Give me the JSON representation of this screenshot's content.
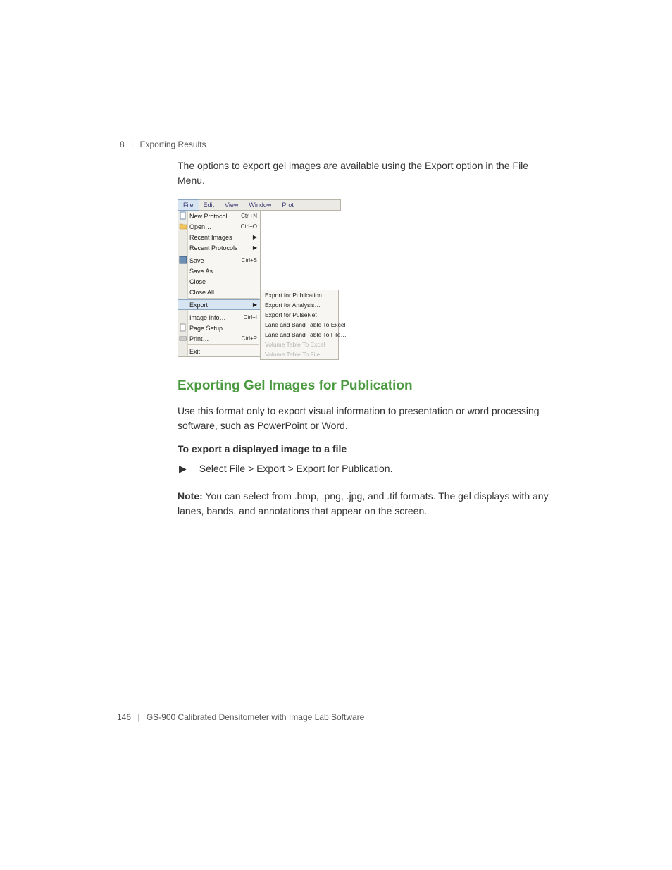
{
  "header": {
    "chapter": "8",
    "title": "Exporting Results"
  },
  "intro": "The options to export gel images are available using the Export option in the File Menu.",
  "menubar": [
    "File",
    "Edit",
    "View",
    "Window",
    "Prot"
  ],
  "menu": {
    "new_protocol": "New Protocol…",
    "new_protocol_sc": "Ctrl+N",
    "open": "Open…",
    "open_sc": "Ctrl+O",
    "recent_images": "Recent Images",
    "recent_protocols": "Recent Protocols",
    "save": "Save",
    "save_sc": "Ctrl+S",
    "save_as": "Save As…",
    "close": "Close",
    "close_all": "Close All",
    "export": "Export",
    "image_info": "Image Info…",
    "image_info_sc": "Ctrl+I",
    "page_setup": "Page Setup…",
    "print": "Print…",
    "print_sc": "Ctrl+P",
    "exit": "Exit"
  },
  "submenu": {
    "pub": "Export for Publication…",
    "analysis": "Export for Analysis…",
    "pulsenet": "Export for PulseNet",
    "lane_excel": "Lane and Band Table To Excel",
    "lane_file": "Lane and Band Table To File…",
    "vol_excel": "Volume Table To Excel",
    "vol_file": "Volume Table To File…"
  },
  "section_title": "Exporting Gel Images for Publication",
  "section_body": "Use this format only to export visual information to presentation or word processing software, such as PowerPoint or Word.",
  "subhead": "To export a displayed image to a file",
  "step1": "Select File > Export > Export for Publication.",
  "note_label": "Note:",
  "note_body": "You can select from .bmp, .png, .jpg, and .tif formats. The gel displays with any lanes, bands, and annotations that appear on the screen.",
  "footer": {
    "page": "146",
    "product": "GS-900 Calibrated Densitometer with Image Lab Software"
  }
}
